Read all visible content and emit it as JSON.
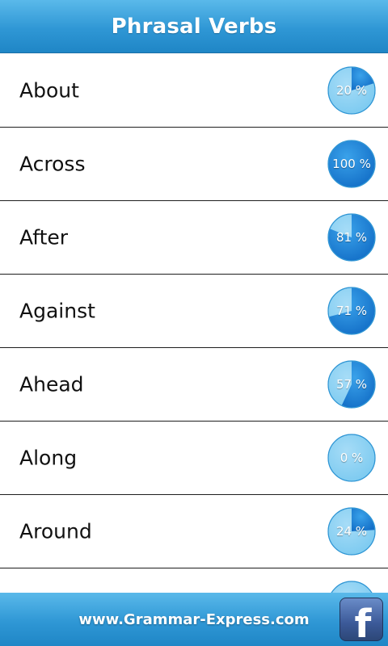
{
  "header": {
    "title": "Phrasal Verbs"
  },
  "list": {
    "items": [
      {
        "label": "About",
        "progress": 20,
        "progress_text": "20 %"
      },
      {
        "label": "Across",
        "progress": 100,
        "progress_text": "100 %"
      },
      {
        "label": "After",
        "progress": 81,
        "progress_text": "81 %"
      },
      {
        "label": "Against",
        "progress": 71,
        "progress_text": "71 %"
      },
      {
        "label": "Ahead",
        "progress": 57,
        "progress_text": "57 %"
      },
      {
        "label": "Along",
        "progress": 0,
        "progress_text": "0 %"
      },
      {
        "label": "Around",
        "progress": 24,
        "progress_text": "24 %"
      }
    ]
  },
  "footer": {
    "url": "www.Grammar-Express.com",
    "facebook_icon": "facebook-icon",
    "facebook_glyph": "f"
  },
  "colors": {
    "header_blue": "#2f97d5",
    "badge_light": "#7ccaf0",
    "badge_dark": "#1470c8",
    "divider": "#1e1e1e"
  }
}
